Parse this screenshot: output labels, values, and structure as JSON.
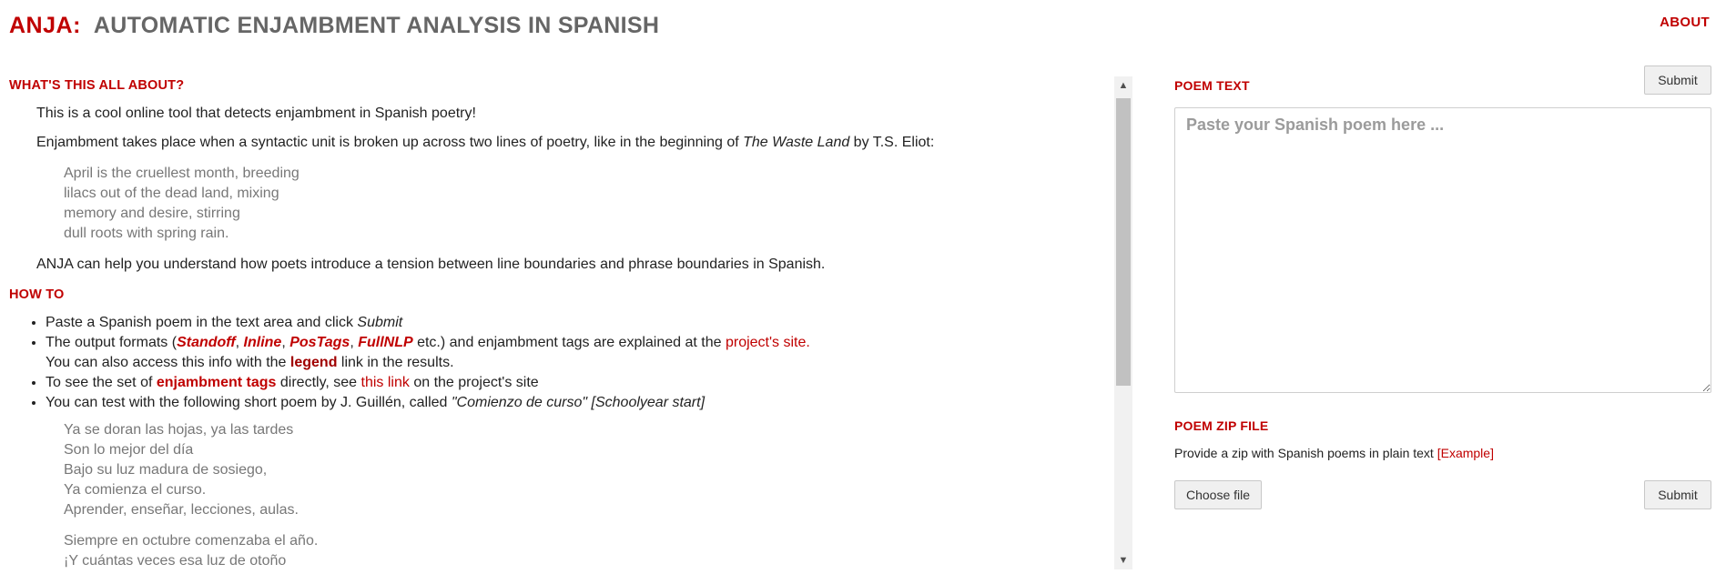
{
  "header": {
    "brand": "ANJA:",
    "subtitle": "AUTOMATIC ENJAMBMENT ANALYSIS IN SPANISH",
    "about": "ABOUT"
  },
  "intro": {
    "title": "WHAT'S THIS ALL ABOUT?",
    "p1": "This is a cool online tool that detects enjambment in Spanish poetry!",
    "p2_before": "Enjambment takes place when a syntactic unit is broken up across two lines of poetry, like in the beginning of ",
    "p2_italic": "The Waste Land",
    "p2_after": " by T.S. Eliot:",
    "verse": [
      "April is the cruellest month, breeding",
      "lilacs out of the dead land, mixing",
      "memory and desire, stirring",
      "dull roots with spring rain."
    ],
    "p3": "ANJA can help you understand how poets introduce a tension between line boundaries and phrase boundaries in Spanish."
  },
  "howto": {
    "title": "HOW TO",
    "item1_text": "Paste a Spanish poem in the text area and click ",
    "item1_italic": "Submit",
    "item2_a": "The output formats (",
    "formats": [
      "Standoff",
      "Inline",
      "PosTags",
      "FullNLP"
    ],
    "comma": ", ",
    "item2_b": " etc.) and enjambment tags are explained at the ",
    "item2_link": "project's site.",
    "item2_c": "You can also access this info with the ",
    "item2_legend": "legend",
    "item2_d": " link in the results.",
    "item3_a": "To see the set of ",
    "item3_bold": "enjambment tags",
    "item3_b": " directly, see ",
    "item3_link": "this link",
    "item3_c": " on the project's site",
    "item4_text": "You can test with the following short poem by J. Guillén, called ",
    "item4_italic": "\"Comienzo de curso\" [Schoolyear start]",
    "poem_stanza1": [
      "Ya se doran las hojas, ya las tardes",
      "Son lo mejor del día",
      "Bajo su luz madura de sosiego,",
      "Ya comienza el curso.",
      "Aprender, enseñar, lecciones, aulas."
    ],
    "poem_stanza2": [
      "Siempre en octubre comenzaba el año.",
      "¡Y cuántas veces esa luz de otoño"
    ]
  },
  "poem_text": {
    "label": "POEM TEXT",
    "submit": "Submit",
    "placeholder": "Paste your Spanish poem here ..."
  },
  "poem_zip": {
    "label": "POEM ZIP FILE",
    "desc": "Provide a zip with Spanish poems in plain text ",
    "example": "[Example]",
    "choose": "Choose file",
    "submit": "Submit"
  },
  "colors": {
    "accent": "#c00000",
    "subtitle": "#666666",
    "verse": "#777777"
  }
}
